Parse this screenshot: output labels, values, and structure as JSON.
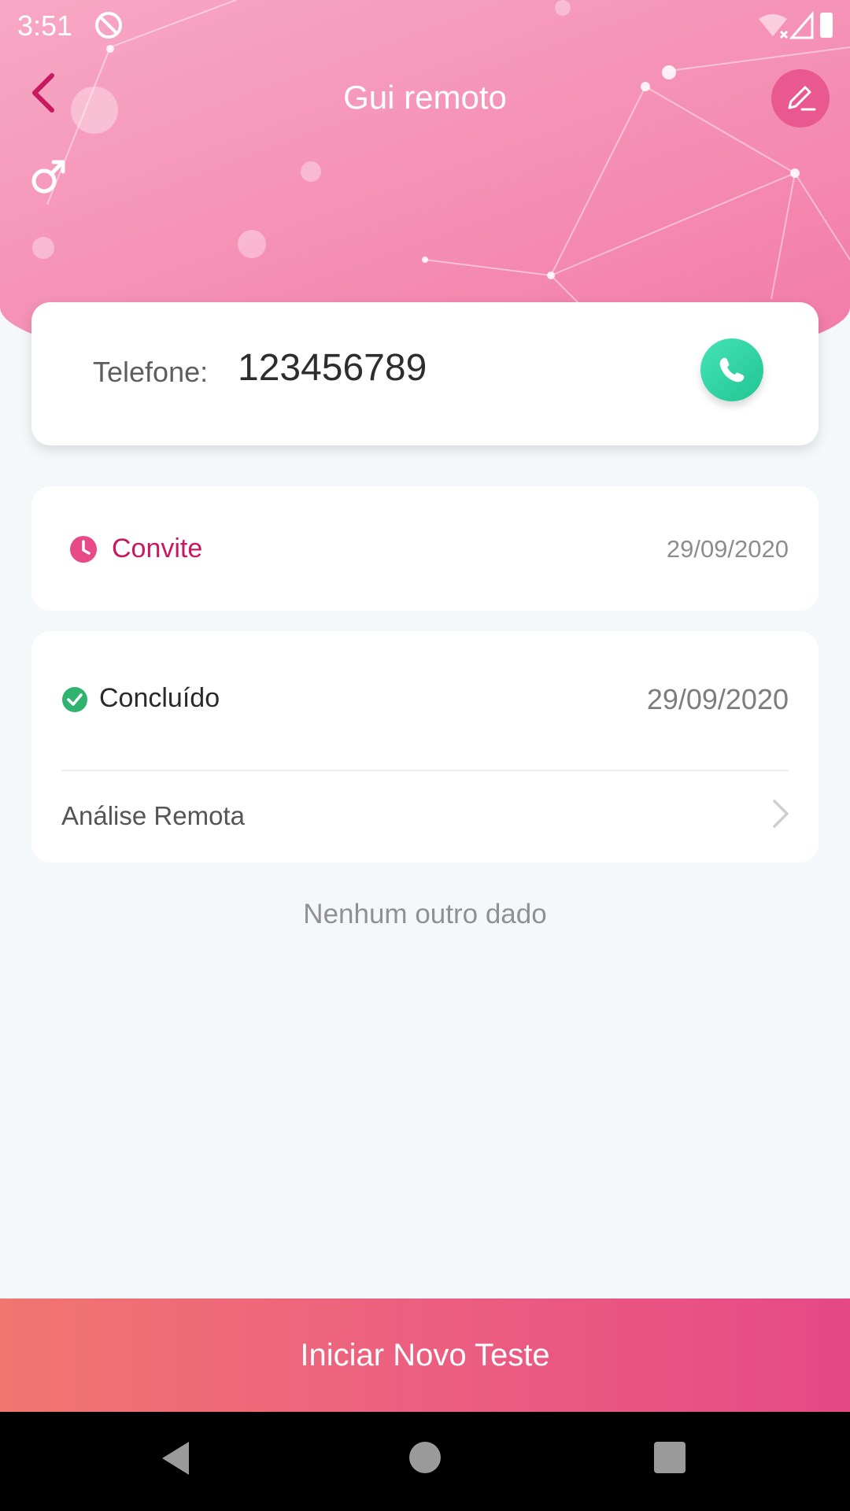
{
  "status_bar": {
    "time": "3:51",
    "icons": [
      "dnd-icon",
      "wifi-off-icon",
      "signal-icon",
      "battery-icon"
    ]
  },
  "header": {
    "title": "Gui remoto",
    "back_icon": "chevron-left-icon",
    "edit_icon": "pencil-icon",
    "gender_icon": "male-symbol-icon"
  },
  "contact": {
    "phone_label": "Telefone:",
    "phone_value": "123456789",
    "call_icon": "phone-icon"
  },
  "records": [
    {
      "status": "Convite",
      "date": "29/09/2020",
      "icon": "clock-icon",
      "color": "#c8185f"
    },
    {
      "status": "Concluído",
      "date": "29/09/2020",
      "icon": "check-circle-icon",
      "color": "#2fb36f",
      "sub_item": {
        "label": "Análise Remota",
        "icon": "chevron-right-icon"
      }
    }
  ],
  "empty_note": "Nenhum outro dado",
  "cta": {
    "label": "Iniciar Novo Teste"
  },
  "colors": {
    "accent": "#c8185f",
    "hero_pink": "#f593b7",
    "call_green": "#22c492",
    "cta_start": "#f07670",
    "cta_end": "#e64986"
  }
}
